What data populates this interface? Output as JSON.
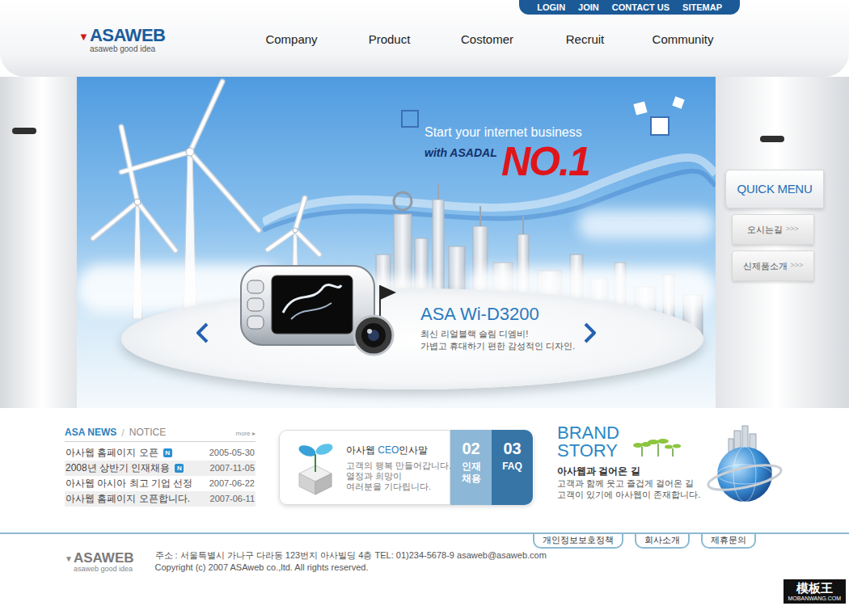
{
  "top_links": [
    "LOGIN",
    "JOIN",
    "CONTACT US",
    "SITEMAP"
  ],
  "logo": {
    "mark": "▼",
    "name": "ASAWEB",
    "tagline": "asaweb good idea"
  },
  "nav": [
    "Company",
    "Product",
    "Costomer",
    "Recruit",
    "Community"
  ],
  "banner": {
    "line1": "Start your internet business",
    "line2": "with ASADAL",
    "badge": "NO.1",
    "product": "ASA Wi-D3200",
    "description": [
      "최신 리얼블랙 슬림 디엠비!",
      "가볍고 휴대하기 편한 감성적인 디자인."
    ]
  },
  "quick_menu": {
    "title": "QUICK MENU",
    "items": [
      {
        "label": "오시는길",
        "arrow": ">>>"
      },
      {
        "label": "신제품소개",
        "arrow": ">>>"
      }
    ]
  },
  "news": {
    "tabs": [
      {
        "label": "ASA NEWS",
        "selected": true
      },
      {
        "label": "NOTICE",
        "selected": false
      }
    ],
    "separator": "/",
    "more": "more ▸",
    "items": [
      {
        "title": "아사웹 홈페이지 오픈",
        "new": true,
        "badge": "N",
        "date": "2005-05-30"
      },
      {
        "title": "2008년 상반기 인재채용",
        "new": true,
        "badge": "N",
        "date": "2007-11-05"
      },
      {
        "title": "아사웹 아시아 최고 기업 선정",
        "new": false,
        "date": "2007-06-22"
      },
      {
        "title": "아사웹 홈페이지 오픈합니다.",
        "new": false,
        "date": "2007-06-11"
      }
    ]
  },
  "ceo": {
    "title_pre": "아사웹 ",
    "title_em": "CEO",
    "title_post": "인사말",
    "lines": [
      "고객의 행복 만들어갑니다.",
      "열정과 희망이",
      "여러분을 기다립니다."
    ]
  },
  "quick_tabs": [
    {
      "number": "02",
      "label": "인재 채용"
    },
    {
      "number": "03",
      "label": "FAQ"
    }
  ],
  "brand": {
    "title": [
      "BRAND",
      "STORY"
    ],
    "subtitle": "아사웹과 걸어온 길",
    "lines": [
      "고객과 함께 웃고 즐겁게 걸어온 길",
      "고객이 있기에 아사웹이 존재합니다."
    ]
  },
  "footer": {
    "logo_mark": "▼",
    "logo_name": "ASAWEB",
    "tagline": "asaweb good idea",
    "address": "주소 : 서울특별시 가나구 다라동 123번지 아사빌딩 4층 TEL: 01)234-5678-9 asaweb@asaweb.com",
    "copyright": "Copyright (c) 2007 ASAweb co.,ltd. All rights reserved.",
    "links": [
      "개인정보보호정책",
      "회사소개",
      "제휴문의"
    ]
  },
  "watermark": {
    "name": "模板王",
    "url": "MOBANWANG.COM"
  }
}
